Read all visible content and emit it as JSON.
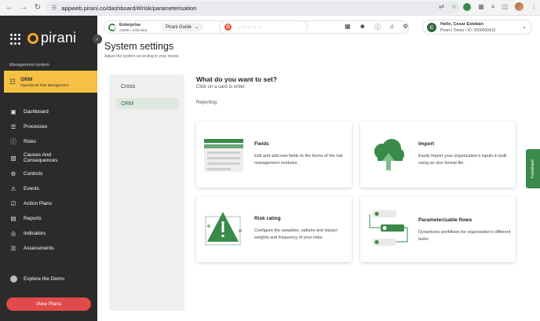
{
  "browser": {
    "url": "appweb.pirani.co/dashboard/#/risk/parameterisation"
  },
  "sidebar": {
    "logo_text": "pirani",
    "section_label": "Management system",
    "orm": {
      "title": "ORM",
      "subtitle": "Operational Risk Management"
    },
    "items": [
      {
        "label": "Dashboard",
        "icon": "monitor-icon"
      },
      {
        "label": "Processes",
        "icon": "list-icon"
      },
      {
        "label": "Risks",
        "icon": "alert-circle-icon"
      },
      {
        "label": "Causes And Consequences",
        "icon": "flow-icon"
      },
      {
        "label": "Controls",
        "icon": "sliders-icon"
      },
      {
        "label": "Events",
        "icon": "warning-icon"
      },
      {
        "label": "Action Plans",
        "icon": "check-square-icon"
      },
      {
        "label": "Reports",
        "icon": "file-icon"
      },
      {
        "label": "Indicators",
        "icon": "target-icon"
      },
      {
        "label": "Assessments",
        "icon": "checklist-icon"
      }
    ],
    "explore_demo": "Explore the Demo",
    "view_plans": "View Plans"
  },
  "header": {
    "plan_title": "Enterprise",
    "plan_sub": "33866 / Unlimited",
    "guide_label": "Pirani Guide",
    "user_greeting": "Hello, Cesar Esteban",
    "user_sub": "Pirani | Demo • ID: 0000000419",
    "avatar_letter": "C"
  },
  "main": {
    "title": "System settings",
    "subtitle": "Adjust the system according to your needs.",
    "tabs": [
      {
        "label": "Cross",
        "active": false
      },
      {
        "label": "ORM",
        "active": true
      }
    ],
    "question": "What do you want to set?",
    "instruction": "Click on a card to enter.",
    "section": "Reporting",
    "cards": [
      {
        "title": "Fields",
        "desc": "Edit and add new fields to the forms of the risk management modules."
      },
      {
        "title": "Import",
        "desc": "Easily import your organization's inputs in bulk using an xlsx format file."
      },
      {
        "title": "Risk rating",
        "desc": "Configure the variables, options and impact weights and frequency of your risks."
      },
      {
        "title": "Parameterizable flows",
        "desc": "Dynamizes workflows for organization's different tasks"
      }
    ]
  },
  "feedback_label": "Feedback",
  "colors": {
    "accent_green": "#3a8a4a",
    "sidebar_bg": "#2b2b2b",
    "orm_yellow": "#f5c043",
    "view_plans_red": "#e04a4a"
  }
}
